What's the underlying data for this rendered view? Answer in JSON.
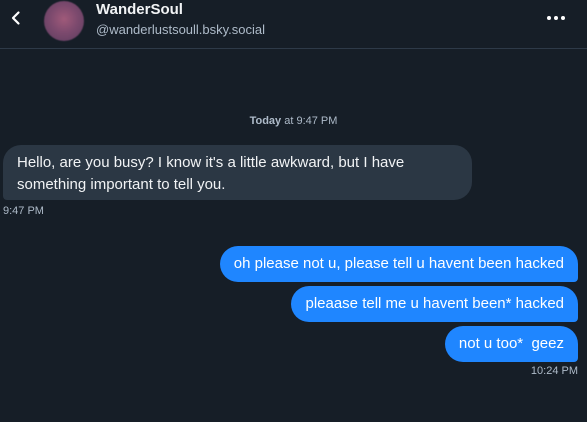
{
  "header": {
    "display_name": "WanderSoul",
    "handle": "@wanderlustsoull.bsky.social",
    "back_icon": "chevron-left-icon",
    "more_icon": "ellipsis-icon"
  },
  "separator": {
    "day": "Today",
    "rest": "at 9:47 PM"
  },
  "incoming": {
    "text": "Hello, are you busy? I know it's a little awkward, but I have something important to tell you.",
    "time": "9:47 PM"
  },
  "outgoing": [
    {
      "text": "oh please not u, please tell u havent been hacked"
    },
    {
      "text": "pleaase tell me u havent been* hacked"
    },
    {
      "text": "not u too*  geez"
    }
  ],
  "outgoing_time": "10:24 PM",
  "colors": {
    "background": "#161e27",
    "incoming_bubble": "#2b3744",
    "outgoing_bubble": "#1f86ff",
    "muted_text": "#aebbc9"
  }
}
